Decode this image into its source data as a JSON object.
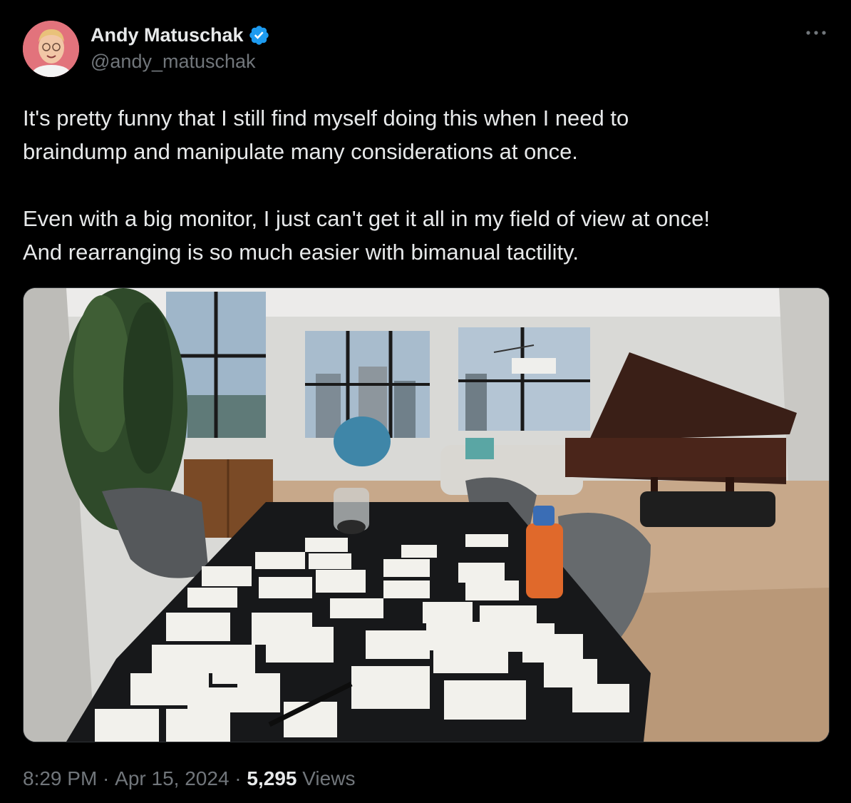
{
  "author": {
    "display_name": "Andy Matuschak",
    "handle": "@andy_matuschak",
    "verified_icon": "verified-badge-icon",
    "accent": "#1d9bf0"
  },
  "tweet": {
    "text": "It's pretty funny that I still find myself doing this when I need to\nbraindump and manipulate many considerations at once.\n\nEven with a big monitor, I just can't get it all in my field of view at once!\nAnd rearranging is so much easier with bimanual tactility."
  },
  "meta": {
    "time": "8:29 PM",
    "separator": " · ",
    "date": "Apr 15, 2024",
    "views_count": "5,295",
    "views_label": " Views"
  },
  "icons": {
    "more": "more-options-icon"
  }
}
